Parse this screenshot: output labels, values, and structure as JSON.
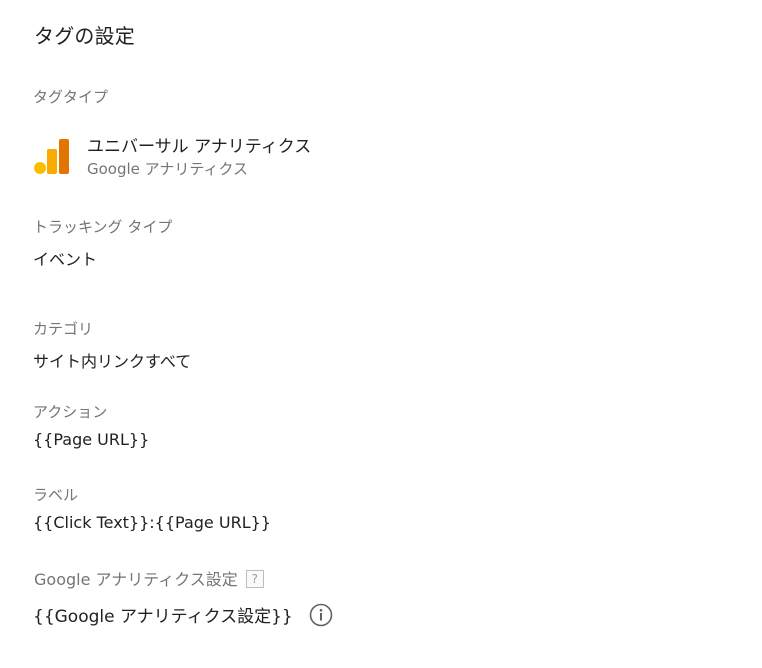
{
  "panel": {
    "title": "タグの設定"
  },
  "tag_type": {
    "label": "タグタイプ",
    "name": "ユニバーサル アナリティクス",
    "provider": "Google アナリティクス",
    "icon": "google-analytics-logo-icon"
  },
  "tracking_type": {
    "label": "トラッキング タイプ",
    "value": "イベント"
  },
  "category": {
    "label": "カテゴリ",
    "value": "サイト内リンクすべて"
  },
  "action": {
    "label": "アクション",
    "value": "{{Page URL}}"
  },
  "event_label": {
    "label": "ラベル",
    "value": "{{Click Text}}:{{Page URL}}"
  },
  "ga_settings": {
    "label": "Google アナリティクス設定",
    "help_glyph": "?",
    "value": "{{Google アナリティクス設定}}",
    "info_icon": "info-icon"
  },
  "colors": {
    "text_primary": "#212121",
    "text_secondary": "#757575",
    "ga_orange": "#e37400",
    "ga_yellow": "#f9ab00"
  }
}
